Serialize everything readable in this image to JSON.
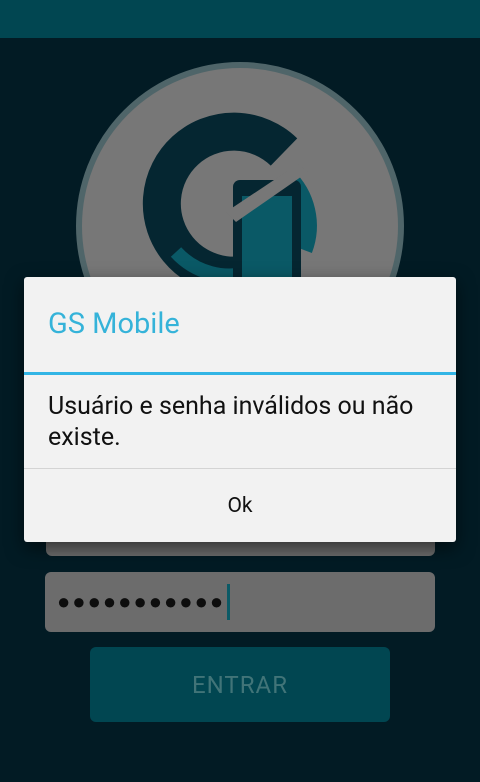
{
  "colors": {
    "background": "#021b24",
    "status_bar": "#014651",
    "logo_circle": "#777777",
    "input_background": "#6c6c6c",
    "button_background": "#014651",
    "dialog_accent": "#35b3d9"
  },
  "logo": {
    "icon": "gs-mobile-logo"
  },
  "login_form": {
    "password_value": "●●●●●●●●●●●",
    "login_button_label": "ENTRAR"
  },
  "dialog": {
    "title": "GS Mobile",
    "message": "Usuário e senha inválidos ou não existe.",
    "ok_label": "Ok"
  }
}
